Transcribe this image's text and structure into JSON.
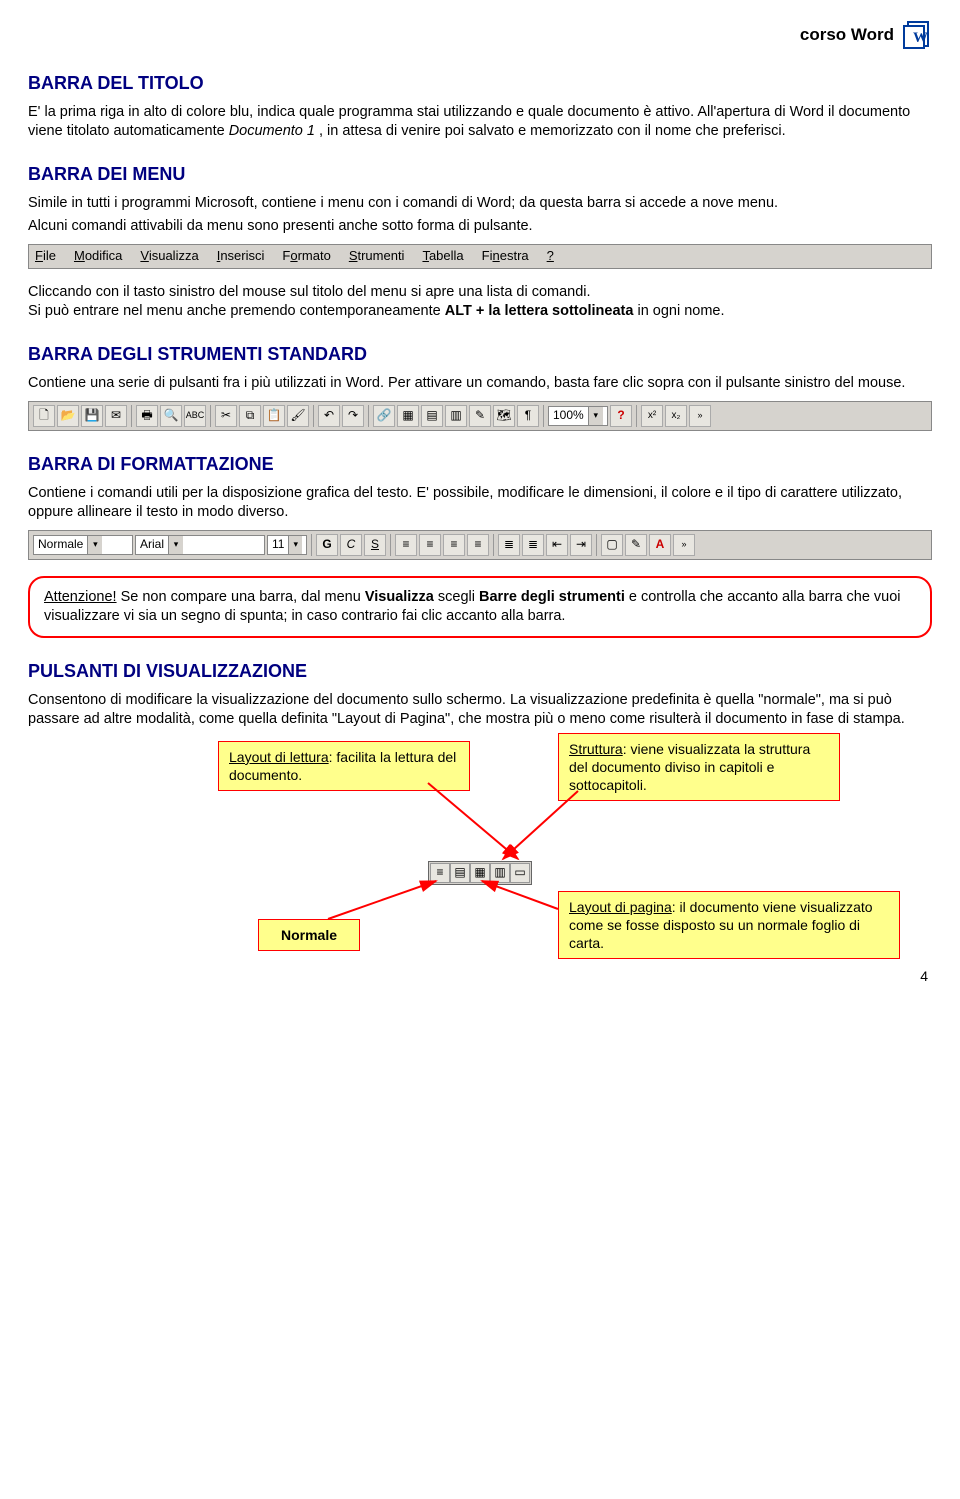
{
  "header": {
    "title": "corso Word"
  },
  "s1": {
    "title": "BARRA DEL TITOLO",
    "p1": "E' la prima riga in alto di colore blu, indica quale programma stai utilizzando e quale documento è attivo. All'apertura di Word il documento viene titolato automaticamente ",
    "doc1": "Documento 1",
    "p1b": " , in attesa di venire poi salvato e memorizzato con il nome che preferisci."
  },
  "s2": {
    "title": "BARRA DEI MENU",
    "p1": "Simile in tutti i programmi Microsoft, contiene i menu con i comandi di Word; da questa barra si accede a nove menu.",
    "p2": "Alcuni comandi attivabili da menu sono presenti anche sotto forma di pulsante.",
    "menu": [
      "File",
      "Modifica",
      "Visualizza",
      "Inserisci",
      "Formato",
      "Strumenti",
      "Tabella",
      "Finestra",
      "?"
    ],
    "p3a": "Cliccando con il tasto sinistro del mouse sul titolo del menu si apre una lista di comandi.",
    "p3b": "Si può entrare nel menu anche premendo contemporaneamente ",
    "alt": "ALT + la lettera sottolineata",
    "p3c": " in ogni nome."
  },
  "s3": {
    "title": "BARRA DEGLI STRUMENTI STANDARD",
    "p1": "Contiene una serie di pulsanti fra i più utilizzati in Word. Per attivare un comando, basta fare clic sopra con il pulsante sinistro del mouse.",
    "zoom": "100%"
  },
  "s4": {
    "title": "BARRA DI FORMATTAZIONE",
    "p1": "Contiene i comandi utili per la disposizione grafica del testo. E' possibile, modificare le dimensioni, il colore e il tipo di carattere utilizzato, oppure allineare il testo in modo diverso.",
    "style": "Normale",
    "font": "Arial",
    "size": "11"
  },
  "attention": {
    "lead": "Attenzione!",
    "t1": " Se non compare una barra, dal menu ",
    "b1": "Visualizza",
    "t2": "  scegli  ",
    "b2": "Barre degli strumenti",
    "t3": " e controlla che accanto alla barra che vuoi visualizzare vi sia un segno di spunta; in caso contrario fai clic accanto alla barra."
  },
  "s5": {
    "title": "PULSANTI DI VISUALIZZAZIONE",
    "p1": "Consentono di modificare la visualizzazione del documento sullo schermo. La visualizzazione predefinita è quella \"normale\", ma si può passare ad altre modalità, come quella definita \"Layout di Pagina\", che mostra più o meno come risulterà il documento in fase di stampa."
  },
  "boxes": {
    "lettura_label": "Layout di lettura",
    "lettura_text": ": facilita la lettura del documento.",
    "struttura_label": "Struttura",
    "struttura_text": ": viene visualizzata la struttura del documento diviso in capitoli e sottocapitoli.",
    "normale_label": "Normale",
    "pagina_label": "Layout di pagina",
    "pagina_text": ": il documento viene visualizzato come se fosse disposto su un normale foglio di carta."
  },
  "page_number": "4"
}
